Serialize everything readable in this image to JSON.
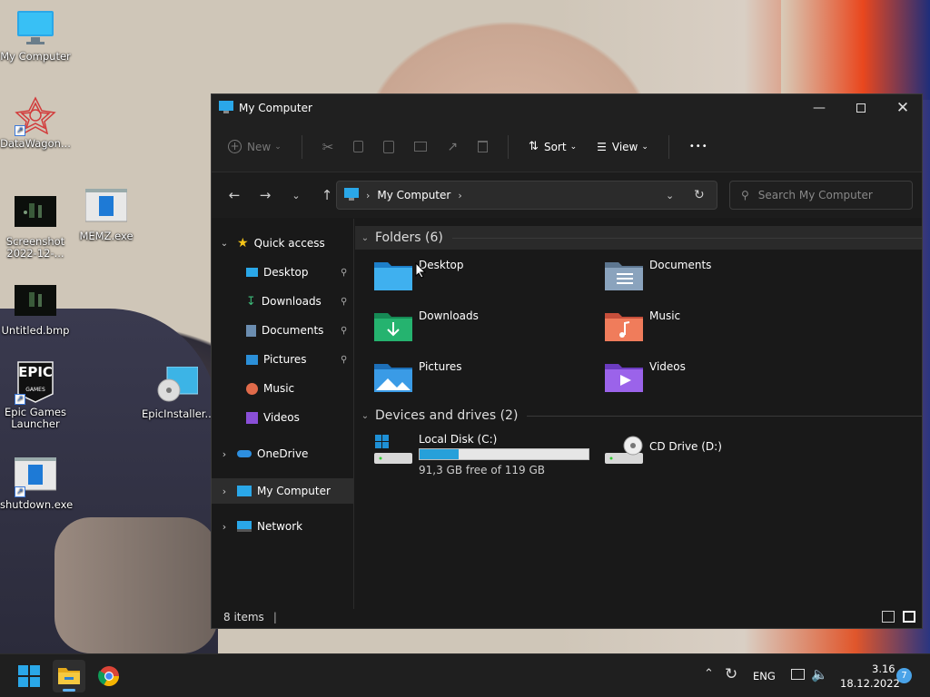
{
  "desktop": {
    "icons": [
      {
        "label": "My Computer"
      },
      {
        "label": "DataWagon..."
      },
      {
        "label": "Screenshot 2022-12-..."
      },
      {
        "label": "MEMZ.exe"
      },
      {
        "label": "Untitled.bmp"
      },
      {
        "label": "Epic Games Launcher"
      },
      {
        "label": "EpicInstaller..."
      },
      {
        "label": "shutdown.exe"
      }
    ],
    "epic_logo_text": "EPIC",
    "epic_logo_sub": "GAMES"
  },
  "window": {
    "title": "My Computer",
    "toolbar": {
      "new_label": "New",
      "sort_label": "Sort",
      "view_label": "View",
      "more_label": "•••"
    },
    "address": {
      "crumb": "My Computer"
    },
    "search": {
      "placeholder": "Search My Computer"
    },
    "sidebar": {
      "quick_access": "Quick access",
      "items": [
        {
          "label": "Desktop",
          "icon": "desktop-icon",
          "pinned": true
        },
        {
          "label": "Downloads",
          "icon": "downloads-icon",
          "pinned": true
        },
        {
          "label": "Documents",
          "icon": "documents-icon",
          "pinned": true
        },
        {
          "label": "Pictures",
          "icon": "pictures-icon",
          "pinned": true
        },
        {
          "label": "Music",
          "icon": "music-icon",
          "pinned": false
        },
        {
          "label": "Videos",
          "icon": "videos-icon",
          "pinned": false
        }
      ],
      "onedrive": "OneDrive",
      "my_computer": "My Computer",
      "network": "Network"
    },
    "folders_header": "Folders (6)",
    "folders": [
      {
        "label": "Desktop"
      },
      {
        "label": "Documents"
      },
      {
        "label": "Downloads"
      },
      {
        "label": "Music"
      },
      {
        "label": "Pictures"
      },
      {
        "label": "Videos"
      }
    ],
    "drives_header": "Devices and drives (2)",
    "drives": {
      "c_label": "Local Disk (C:)",
      "c_free": "91,3 GB free of 119 GB",
      "c_used_fraction": 0.23,
      "d_label": "CD Drive (D:)"
    },
    "status": {
      "items": "8 items"
    }
  },
  "taskbar": {
    "lang": "ENG",
    "time": "3.16",
    "date": "18.12.2022",
    "notifications": "7"
  },
  "colors": {
    "accent": "#1e90d6",
    "folder_blue": "#2d9de0",
    "progress": "#26a0da"
  }
}
